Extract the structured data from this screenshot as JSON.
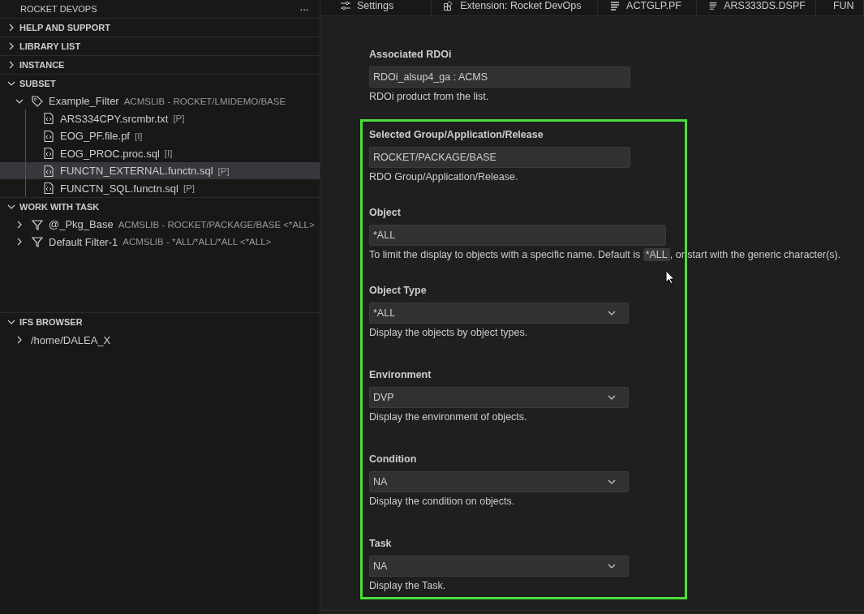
{
  "sidebar": {
    "title": "ROCKET DEVOPS",
    "more_button": "···",
    "sections": [
      {
        "label": "HELP AND SUPPORT",
        "expanded": false
      },
      {
        "label": "LIBRARY LIST",
        "expanded": false
      },
      {
        "label": "INSTANCE",
        "expanded": false
      },
      {
        "label": "SUBSET",
        "expanded": true,
        "items": [
          {
            "kind": "tag",
            "label": "Example_Filter",
            "detail": "ACMSLIB - ROCKET/LMIDEMO/BASE",
            "expanded": true,
            "children": [
              {
                "label": "ARS334CPY.srcmbr.txt",
                "detail": "[P]",
                "selected": false
              },
              {
                "label": "EOG_PF.file.pf",
                "detail": "[I]",
                "selected": false
              },
              {
                "label": "EOG_PROC.proc.sql",
                "detail": "[I]",
                "selected": false
              },
              {
                "label": "FUNCTN_EXTERNAL.functn.sql",
                "detail": "[P]",
                "selected": true
              },
              {
                "label": "FUNCTN_SQL.functn.sql",
                "detail": "[P]",
                "selected": false
              }
            ]
          }
        ]
      },
      {
        "label": "WORK WITH TASK",
        "expanded": true,
        "items": [
          {
            "kind": "filter",
            "label": "@_Pkg_Base",
            "detail": "ACMSLIB - ROCKET/PACKAGE/BASE <*ALL>",
            "expanded": false
          },
          {
            "kind": "filter",
            "label": "Default Filter-1",
            "detail": "ACMSLIB - *ALL/*ALL/*ALL <*ALL>",
            "expanded": false
          }
        ]
      },
      {
        "label": "IFS BROWSER",
        "expanded": true,
        "items": [
          {
            "kind": "folder",
            "label": "/home/DALEA_X",
            "expanded": false
          }
        ]
      }
    ]
  },
  "tabs": [
    {
      "kind": "settings",
      "label": "Settings",
      "selected": false
    },
    {
      "kind": "extension",
      "label": "Extension: Rocket DevOps",
      "selected": false
    },
    {
      "kind": "document",
      "label": "ACTGLP.PF",
      "selected": false
    },
    {
      "kind": "document",
      "label": "ARS333DS.DSPF",
      "selected": false
    },
    {
      "kind": "database",
      "label": "FUN",
      "selected": false
    }
  ],
  "form": {
    "fields": [
      {
        "kind": "text",
        "label": "Associated RDOi",
        "value": "RDOi_alsup4_ga : ACMS",
        "description": [
          {
            "kind": "text",
            "text": "RDOi product from the list."
          }
        ]
      }
    ],
    "highlighted_fields": [
      {
        "kind": "text",
        "label": "Selected Group/Application/Release",
        "value": "ROCKET/PACKAGE/BASE",
        "description": [
          {
            "kind": "text",
            "text": "RDO Group/Application/Release."
          }
        ]
      },
      {
        "kind": "wide",
        "label": "Object",
        "value": "*ALL",
        "description": [
          {
            "kind": "text",
            "text": "To limit the display to objects with a specific name. Default is "
          },
          {
            "kind": "code",
            "text": "*ALL"
          },
          {
            "kind": "text",
            "text": ", or start with the generic character(s)."
          }
        ]
      },
      {
        "kind": "select",
        "label": "Object Type",
        "value": "*ALL",
        "description": [
          {
            "kind": "text",
            "text": "Display the objects by object types."
          }
        ]
      },
      {
        "kind": "select",
        "label": "Environment",
        "value": "DVP",
        "description": [
          {
            "kind": "text",
            "text": "Display the environment of objects."
          }
        ]
      },
      {
        "kind": "select",
        "label": "Condition",
        "value": "NA",
        "description": [
          {
            "kind": "text",
            "text": "Display the condition on objects."
          }
        ]
      },
      {
        "kind": "select",
        "label": "Task",
        "value": "NA",
        "description": [
          {
            "kind": "text",
            "text": "Display the Task."
          }
        ]
      }
    ]
  }
}
